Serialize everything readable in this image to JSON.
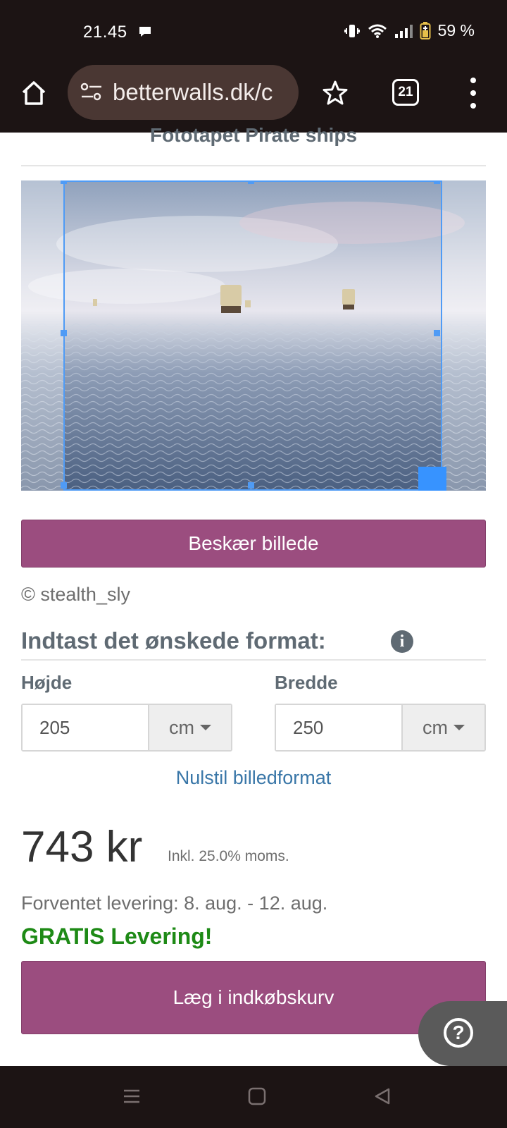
{
  "status_bar": {
    "time": "21.45",
    "battery": "59 %"
  },
  "browser": {
    "url": "betterwalls.dk/c",
    "tab_count": "21"
  },
  "page": {
    "title": "Fototapet Pirate ships",
    "crop_button": "Beskær billede",
    "credit": "© stealth_sly",
    "format_heading": "Indtast det ønskede format:",
    "height_label": "Højde",
    "height_value": "205",
    "height_unit": "cm",
    "width_label": "Bredde",
    "width_value": "250",
    "width_unit": "cm",
    "reset_link": "Nulstil billedformat",
    "price": "743 kr",
    "vat_note": "Inkl. 25.0% moms.",
    "delivery": "Forventet levering: 8. aug. - 12. aug.",
    "free_delivery": "GRATIS Levering!",
    "add_to_cart": "Læg i indkøbskurv"
  },
  "colors": {
    "accent": "#9b4d7f",
    "link": "#3a77a8",
    "free_delivery": "#1e8a16",
    "crop_frame": "#4f9bf5",
    "chrome": "#1c1414"
  },
  "icons": [
    "home-icon",
    "site-settings-icon",
    "star-icon",
    "tabs-icon",
    "more-vert-icon",
    "info-icon",
    "help-icon",
    "recents-icon",
    "home-nav-icon",
    "back-icon"
  ]
}
